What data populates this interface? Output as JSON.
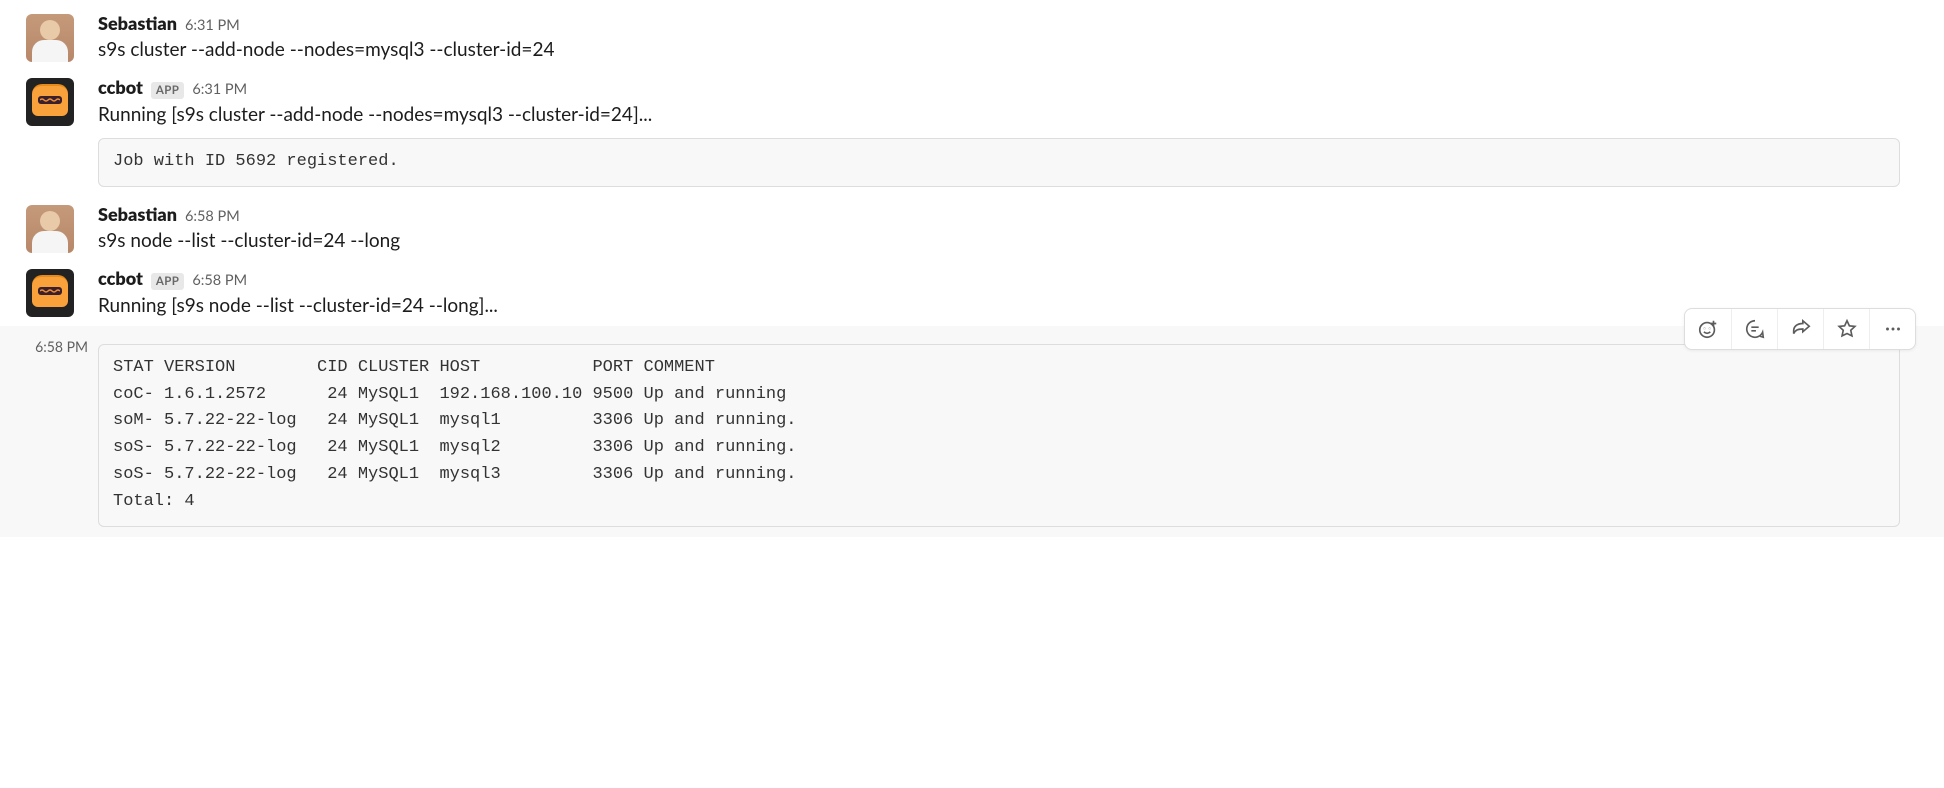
{
  "messages": [
    {
      "kind": "user",
      "author": "Sebastian",
      "ts": "6:31 PM",
      "text": "s9s cluster --add-node --nodes=mysql3 --cluster-id=24"
    },
    {
      "kind": "bot",
      "author": "ccbot",
      "app_badge": "APP",
      "ts": "6:31 PM",
      "text": "Running [s9s cluster --add-node --nodes=mysql3 --cluster-id=24]...",
      "code": "Job with ID 5692 registered."
    },
    {
      "kind": "user",
      "author": "Sebastian",
      "ts": "6:58 PM",
      "text": "s9s node --list --cluster-id=24 --long"
    },
    {
      "kind": "bot",
      "author": "ccbot",
      "app_badge": "APP",
      "ts": "6:58 PM",
      "text": "Running [s9s node --list --cluster-id=24 --long]..."
    },
    {
      "kind": "attach",
      "ts": "6:58 PM",
      "code": "STAT VERSION        CID CLUSTER HOST           PORT COMMENT\ncoC- 1.6.1.2572      24 MySQL1  192.168.100.10 9500 Up and running\nsoM- 5.7.22-22-log   24 MySQL1  mysql1         3306 Up and running.\nsoS- 5.7.22-22-log   24 MySQL1  mysql2         3306 Up and running.\nsoS- 5.7.22-22-log   24 MySQL1  mysql3         3306 Up and running.\nTotal: 4"
    }
  ],
  "actions": {
    "react": "Add reaction",
    "thread": "Start a thread",
    "share": "Share message",
    "save": "Save",
    "more": "More actions"
  }
}
